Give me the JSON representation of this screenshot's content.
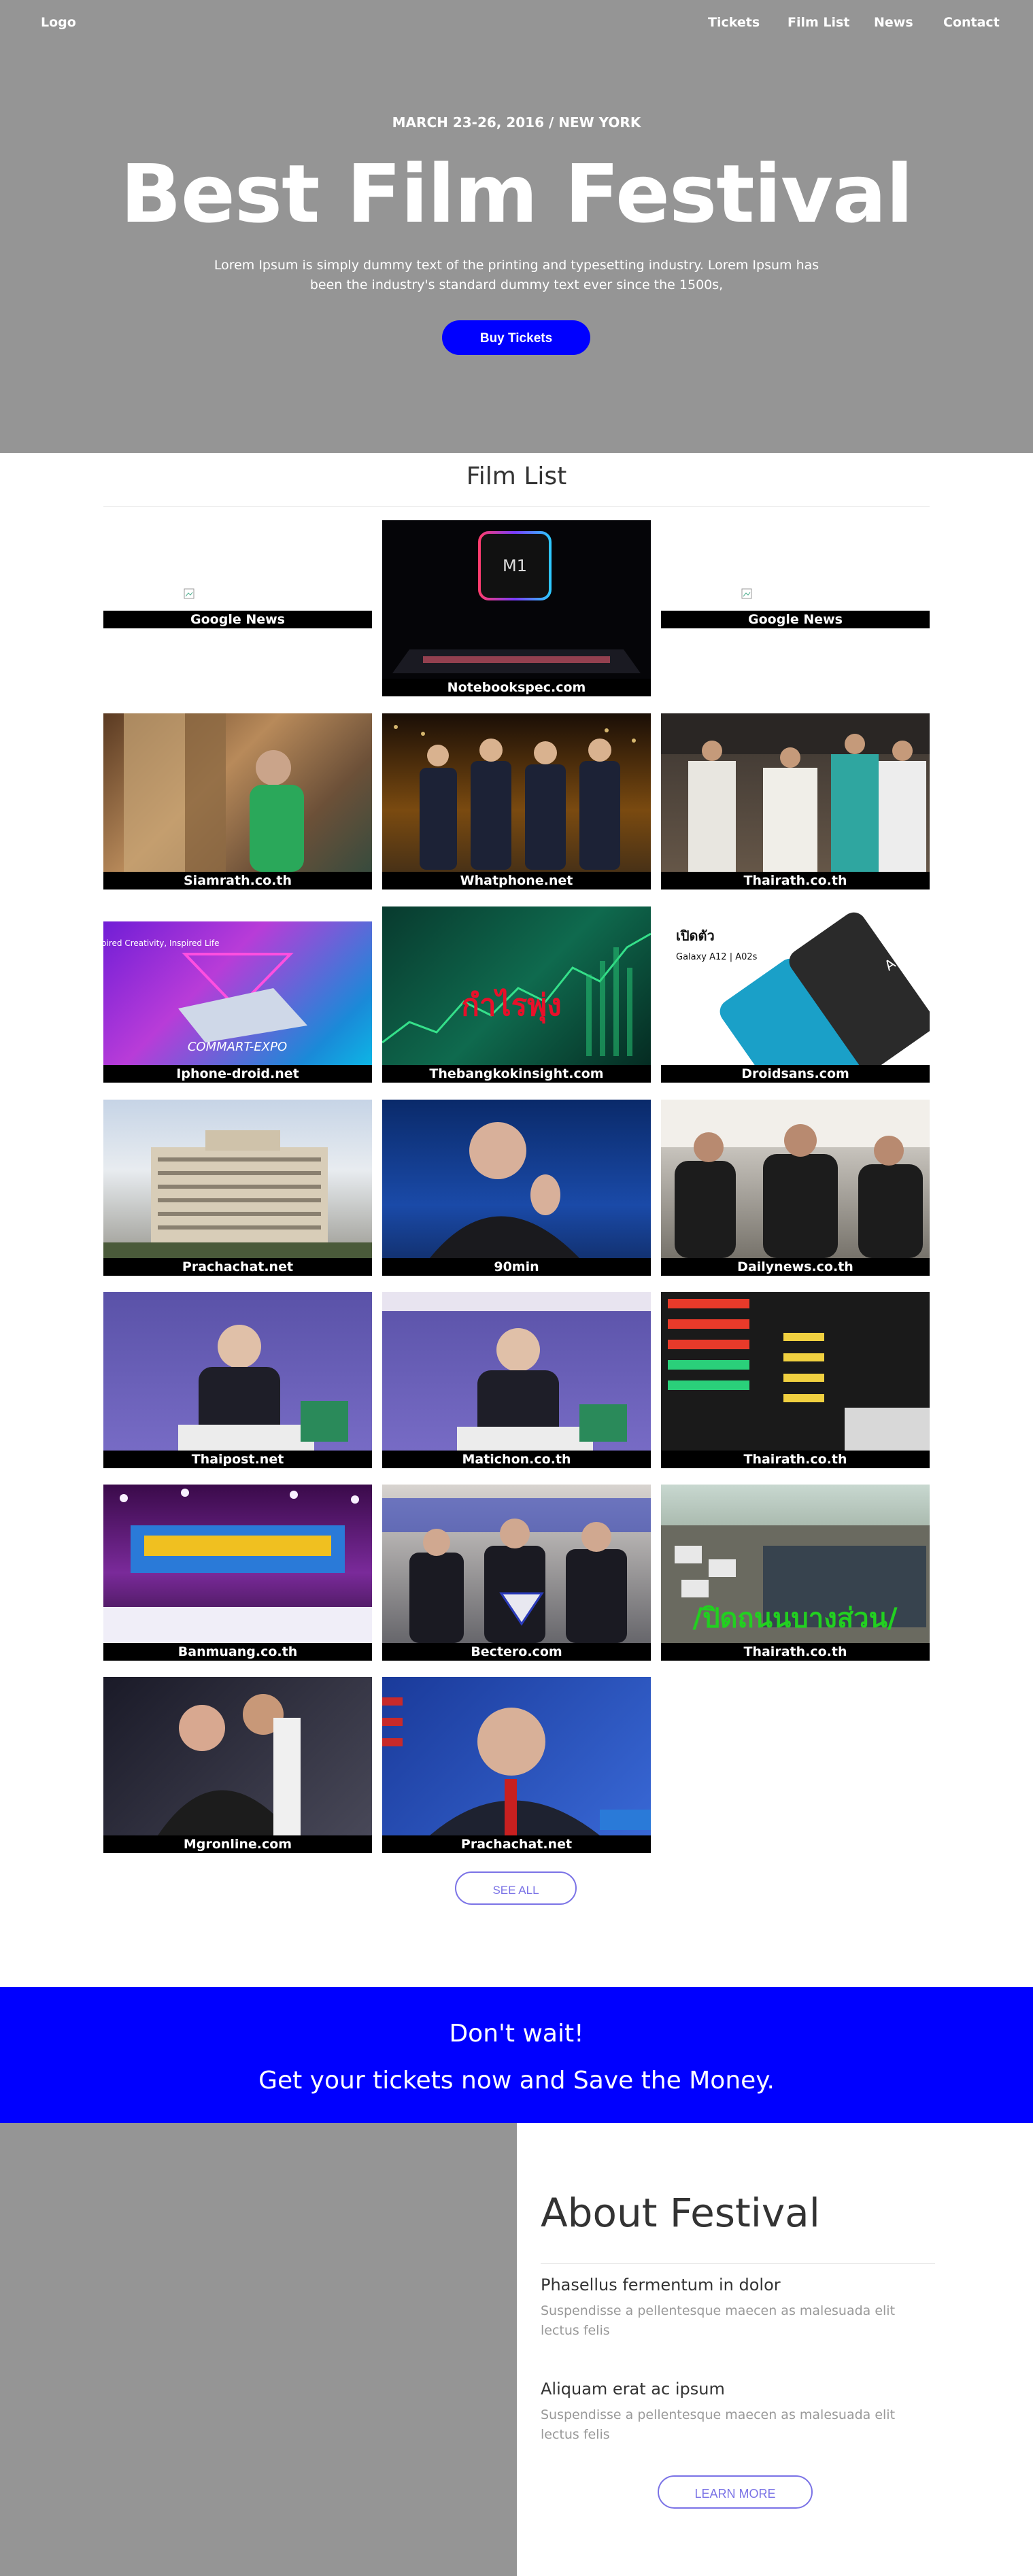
{
  "nav": {
    "logo": "Logo",
    "links": [
      "Tickets",
      "Film List",
      "News",
      "Contact"
    ]
  },
  "hero": {
    "date": "MARCH 23-26, 2016 / NEW YORK",
    "title": "Best Film Festival",
    "description": "Lorem Ipsum is simply dummy text of the printing and typesetting industry. Lorem Ipsum has been the industry's standard dummy text ever since the 1500s,",
    "button": "Buy Tickets"
  },
  "film_list": {
    "title": "Film List",
    "cards": [
      "Google News",
      "Notebookspec.com",
      "Google News",
      "Siamrath.co.th",
      "Whatphone.net",
      "Thairath.co.th",
      "Iphone-droid.net",
      "Thebangkokinsight.com",
      "Droidsans.com",
      "Prachachat.net",
      "90min",
      "Dailynews.co.th",
      "Thaipost.net",
      "Matichon.co.th",
      "Thairath.co.th",
      "Banmuang.co.th",
      "Bectero.com",
      "Thairath.co.th",
      "Mgronline.com",
      "Prachachat.net"
    ],
    "see_all": "SEE ALL"
  },
  "cta": {
    "line1": "Don't wait!",
    "line2": "Get your tickets now and Save the Money."
  },
  "about": {
    "title": "About Festival",
    "items": [
      {
        "heading": "Phasellus fermentum in dolor",
        "text": "Suspendisse a pellentesque maecen as malesuada elit lectus felis"
      },
      {
        "heading": "Aliquam erat ac ipsum",
        "text": "Suspendisse a pellentesque maecen as malesuada elit lectus felis"
      }
    ],
    "button": "LEARN MORE"
  },
  "colors": {
    "hero_bg": "#959595",
    "accent_blue": "#0000ff",
    "outline_button": "#7b73e6"
  }
}
